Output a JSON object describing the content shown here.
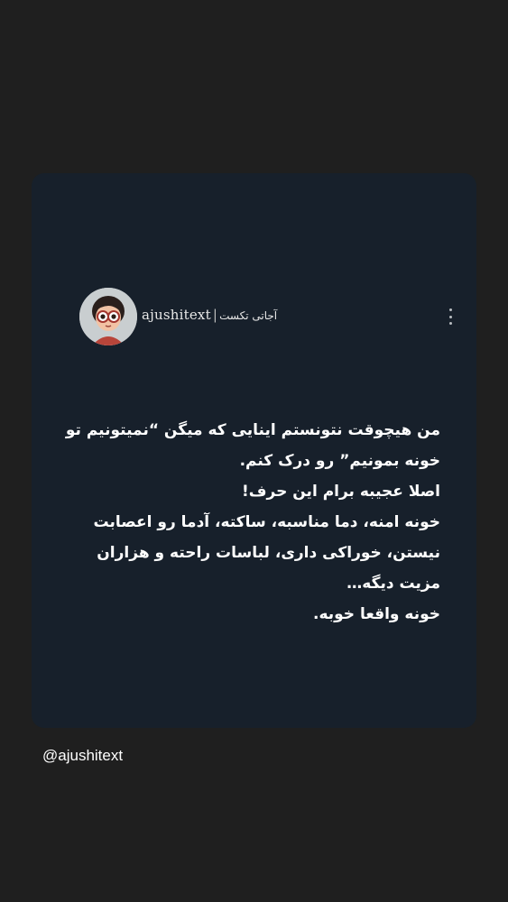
{
  "post": {
    "account": {
      "username": "ajushitext",
      "separator": "|",
      "alias_fa": "آجاتی تکست",
      "avatar_icon": "cartoon-girl-with-glasses-avatar"
    },
    "menu_icon": "vertical-ellipsis-icon",
    "paragraphs": [
      "من هیچوقت نتونستم اینایی که میگن “نمیتونیم تو خونه بمونیم” رو درک کنم.",
      "اصلا عجیبه برام این حرف!",
      "خونه امنه، دما مناسبه، ساکته، آدما رو اعصابت نیستن، خوراکی داری، لباسات راحته و هزاران مزیت دیگه…",
      "خونه واقعا خوبه."
    ]
  },
  "footer": {
    "handle": "@ajushitext"
  },
  "colors": {
    "background": "#1f1f1f",
    "card": "#17202b",
    "text": "#ffffff"
  }
}
